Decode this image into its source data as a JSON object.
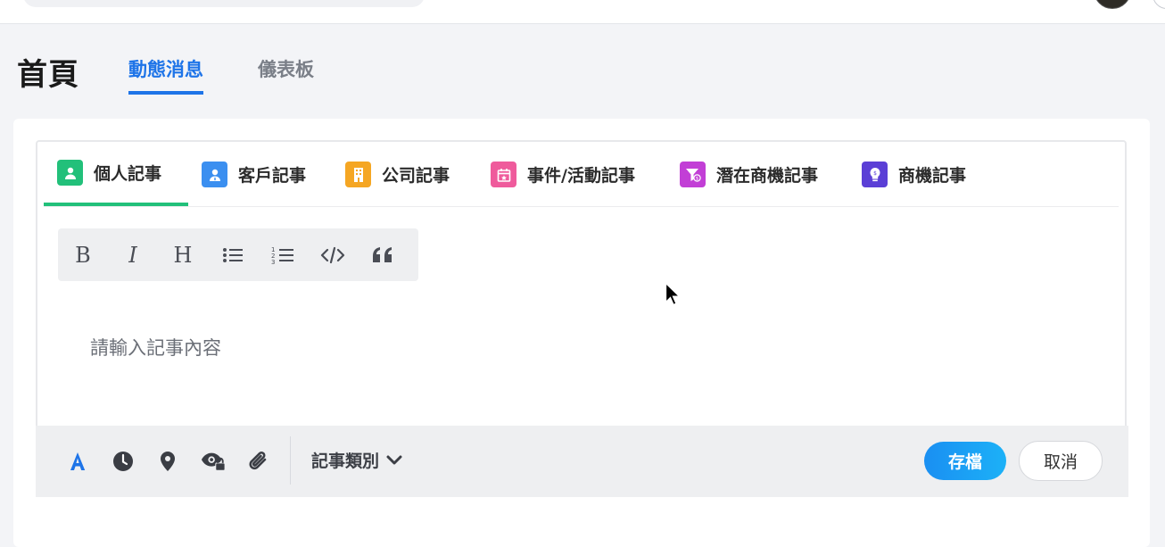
{
  "header": {
    "page_title": "首頁",
    "tabs": [
      {
        "label": "動態消息",
        "active": true
      },
      {
        "label": "儀表板",
        "active": false
      }
    ]
  },
  "note_tabs": [
    {
      "label": "個人記事",
      "icon": "person-icon",
      "color": "#22c07a",
      "active": true
    },
    {
      "label": "客戶記事",
      "icon": "customer-icon",
      "color": "#3b8ff0",
      "active": false
    },
    {
      "label": "公司記事",
      "icon": "building-icon",
      "color": "#f5a623",
      "active": false
    },
    {
      "label": "事件/活動記事",
      "icon": "calendar-icon",
      "color": "#ef5b9c",
      "active": false
    },
    {
      "label": "潛在商機記事",
      "icon": "funnel-icon",
      "color": "#c23fd6",
      "active": false
    },
    {
      "label": "商機記事",
      "icon": "lightbulb-icon",
      "color": "#5b3fd6",
      "active": false
    }
  ],
  "format_toolbar": {
    "bold": "B",
    "italic": "I",
    "heading": "H"
  },
  "editor": {
    "placeholder": "請輸入記事內容"
  },
  "footer": {
    "category_label": "記事類別",
    "save_label": "存檔",
    "cancel_label": "取消"
  },
  "colors": {
    "accent": "#1e74e8",
    "active_note_tab": "#22c07a",
    "save_button": "#1a8ff2"
  }
}
